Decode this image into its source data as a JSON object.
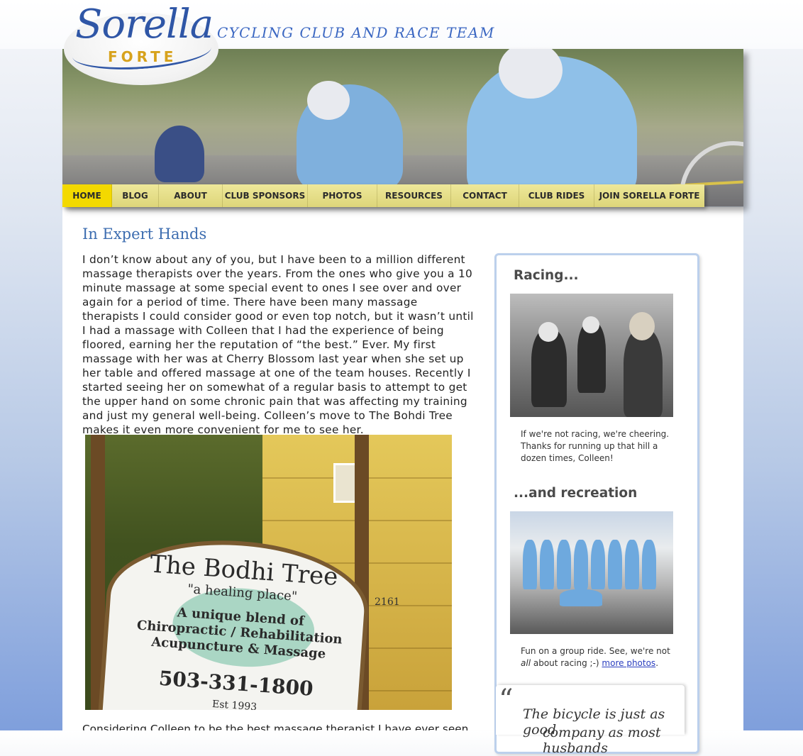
{
  "site": {
    "logo_script": "Sorella",
    "logo_sub": "FORTE",
    "tagline": "CYCLING CLUB AND RACE TEAM"
  },
  "nav": [
    {
      "label": "HOME",
      "active": true
    },
    {
      "label": "BLOG"
    },
    {
      "label": "ABOUT"
    },
    {
      "label": "CLUB SPONSORS"
    },
    {
      "label": "PHOTOS"
    },
    {
      "label": "RESOURCES"
    },
    {
      "label": "CONTACT"
    },
    {
      "label": "CLUB RIDES"
    },
    {
      "label": "JOIN SORELLA FORTE"
    }
  ],
  "post": {
    "title": "In Expert Hands",
    "body": "I don’t know about any of you, but I have been to a million different massage therapists over the years. From the ones who give you a 10 minute massage at some special event to ones I see over and over again for a period of time. There have been many massage therapists I could consider good or even top notch, but it wasn’t until I had a massage with Colleen that I had the experience of being floored, earning her the reputation of “the best.” Ever. My first massage with her was at Cherry Blossom last year when she set up her table and offered massage at one of the team houses. Recently I started seeing her on somewhat of a regular basis to attempt to get the upper hand on some chronic pain that was affecting my training and just my general well-being. Colleen’s move to The Bohdi Tree makes it even more convenient for me to see her.",
    "continued": "Considering Colleen to be the best massage therapist I have ever seen, I",
    "photo_sign": {
      "name": "The Bodhi Tree",
      "motto": "\"a healing place\"",
      "line1": "A unique blend of",
      "line2": "Chiropractic / Rehabilitation",
      "line3": "Acupuncture & Massage",
      "phone": "503-331-1800",
      "est": "Est 1993",
      "address": "2161"
    }
  },
  "sidebar": {
    "racing_heading": "Racing...",
    "racing_caption": "If we're not racing, we're cheering. Thanks for running up that hill a dozen times, Colleen!",
    "recreation_heading": "...and recreation",
    "recreation_caption_pre": "Fun on a group ride. See, we're not ",
    "recreation_caption_em": "all",
    "recreation_caption_mid": " about racing ;-) ",
    "recreation_caption_link": "more photos",
    "recreation_caption_post": ".",
    "quote_mark": "“",
    "quote_line1": "The bicycle is just as good",
    "quote_line2": "company as most husbands"
  }
}
